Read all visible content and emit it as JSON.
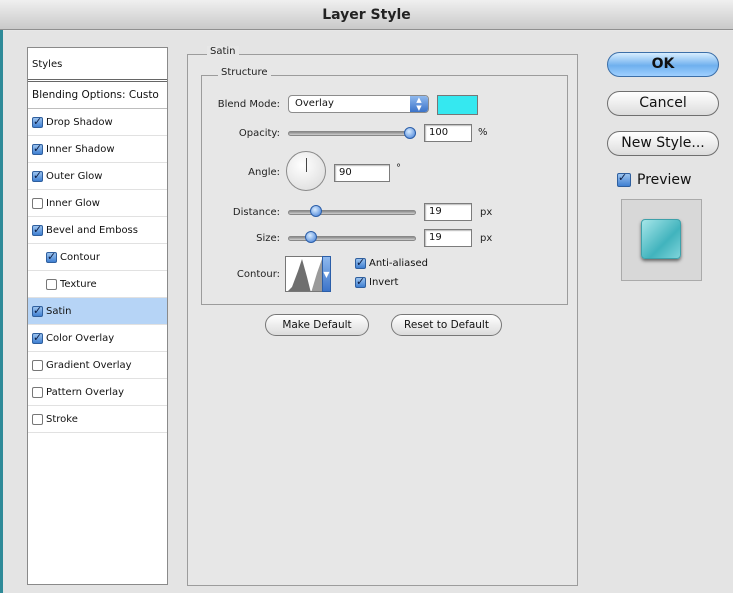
{
  "window": {
    "title": "Layer Style"
  },
  "styles_panel": {
    "header": "Styles",
    "items": [
      {
        "label": "Blending Options: Custo",
        "checkbox": null,
        "indent": false,
        "selected": false
      },
      {
        "label": "Drop Shadow",
        "checkbox": true,
        "indent": false,
        "selected": false
      },
      {
        "label": "Inner Shadow",
        "checkbox": true,
        "indent": false,
        "selected": false
      },
      {
        "label": "Outer Glow",
        "checkbox": true,
        "indent": false,
        "selected": false
      },
      {
        "label": "Inner Glow",
        "checkbox": false,
        "indent": false,
        "selected": false
      },
      {
        "label": "Bevel and Emboss",
        "checkbox": true,
        "indent": false,
        "selected": false
      },
      {
        "label": "Contour",
        "checkbox": true,
        "indent": true,
        "selected": false
      },
      {
        "label": "Texture",
        "checkbox": false,
        "indent": true,
        "selected": false
      },
      {
        "label": "Satin",
        "checkbox": true,
        "indent": false,
        "selected": true
      },
      {
        "label": "Color Overlay",
        "checkbox": true,
        "indent": false,
        "selected": false
      },
      {
        "label": "Gradient Overlay",
        "checkbox": false,
        "indent": false,
        "selected": false
      },
      {
        "label": "Pattern Overlay",
        "checkbox": false,
        "indent": false,
        "selected": false
      },
      {
        "label": "Stroke",
        "checkbox": false,
        "indent": false,
        "selected": false
      }
    ]
  },
  "satin": {
    "group_label": "Satin",
    "structure_label": "Structure",
    "blend_mode": {
      "label": "Blend Mode:",
      "value": "Overlay",
      "color": "#35e8f0"
    },
    "opacity": {
      "label": "Opacity:",
      "value": "100",
      "unit": "%",
      "slider_fraction": 1.0
    },
    "angle": {
      "label": "Angle:",
      "value": "90",
      "unit": "°"
    },
    "distance": {
      "label": "Distance:",
      "value": "19",
      "unit": "px",
      "slider_fraction": 0.19
    },
    "size": {
      "label": "Size:",
      "value": "19",
      "unit": "px",
      "slider_fraction": 0.15
    },
    "contour": {
      "label": "Contour:",
      "anti_aliased_label": "Anti-aliased",
      "anti_aliased": true,
      "invert_label": "Invert",
      "invert": true
    },
    "make_default_label": "Make Default",
    "reset_default_label": "Reset to Default"
  },
  "buttons": {
    "ok": "OK",
    "cancel": "Cancel",
    "new_style": "New Style...",
    "preview_label": "Preview",
    "preview_checked": true
  }
}
